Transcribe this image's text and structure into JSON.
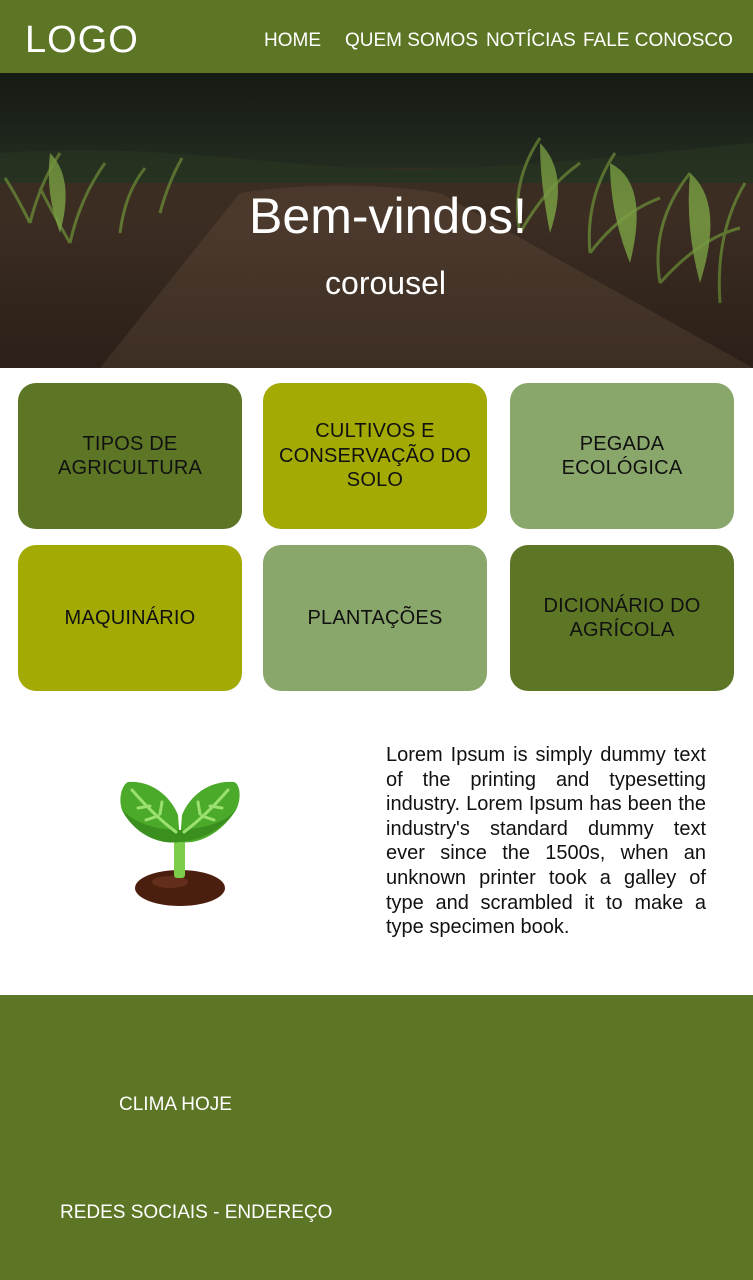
{
  "header": {
    "logo": "LOGO",
    "nav": [
      "HOME",
      "QUEM SOMOS",
      "NOTÍCIAS",
      "FALE CONOSCO"
    ]
  },
  "hero": {
    "title": "Bem-vindos!",
    "subtitle": "corousel"
  },
  "cards": [
    {
      "label": "TIPOS DE AGRICULTURA",
      "color": "#5d7626"
    },
    {
      "label": "CULTIVOS E CONSERVAÇÃO DO SOLO",
      "color": "#a3aa04"
    },
    {
      "label": "PEGADA ECOLÓGICA",
      "color": "#8aa76b"
    },
    {
      "label": "MAQUINÁRIO",
      "color": "#a3aa04"
    },
    {
      "label": "PLANTAÇÕES",
      "color": "#8aa76b"
    },
    {
      "label": "DICIONÁRIO DO AGRÍCOLA",
      "color": "#5d7626"
    }
  ],
  "content": {
    "icon": "sprout-icon",
    "text": "Lorem Ipsum is simply dummy text of the printing and typesetting industry. Lorem Ipsum has been the industry's standard dummy text ever since the 1500s, when an unknown printer took a galley of type and scrambled it to make a type specimen book."
  },
  "footer": {
    "weather": "CLIMA HOJE",
    "social": "REDES SOCIAIS - ENDEREÇO"
  },
  "colors": {
    "primary": "#5d7626",
    "lime": "#a3aa04",
    "sage": "#8aa76b"
  }
}
